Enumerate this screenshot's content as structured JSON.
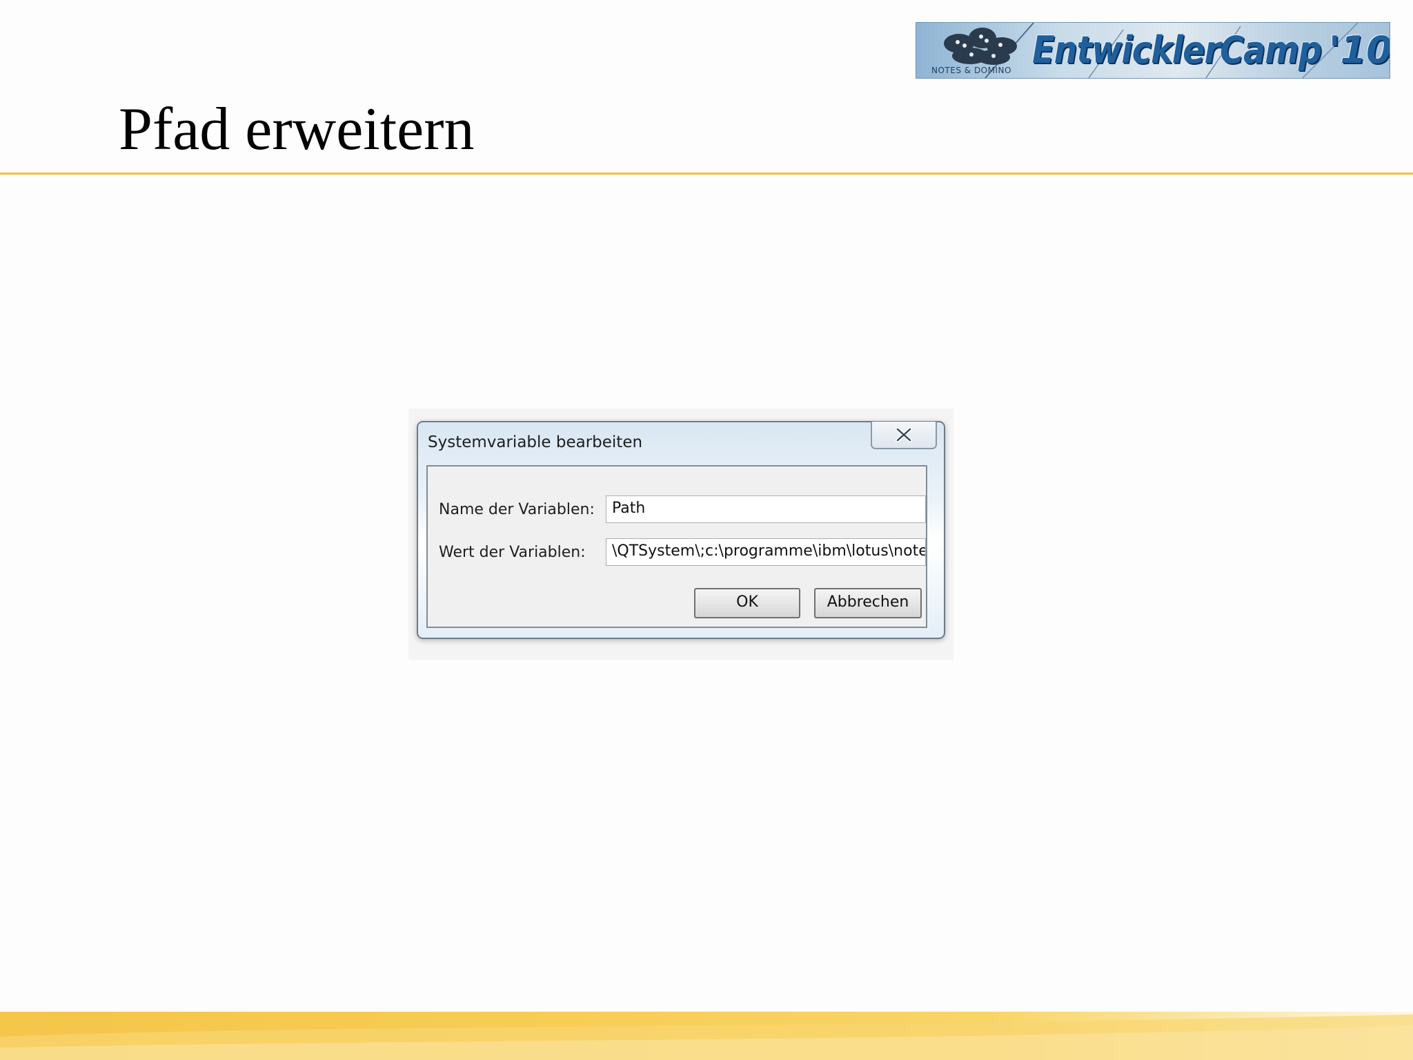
{
  "slide": {
    "title": "Pfad erweitern"
  },
  "logo": {
    "name": "EntwicklerCamp",
    "year": "'10",
    "sub": "NOTES & DOMINO"
  },
  "dialog": {
    "title": "Systemvariable bearbeiten",
    "name_label": "Name der Variablen:",
    "name_value": "Path",
    "value_label": "Wert der Variablen:",
    "value_value": "\\QTSystem\\;c:\\programme\\ibm\\lotus\\notes",
    "ok_label": "OK",
    "cancel_label": "Abbrechen",
    "close_icon": "close-x-icon"
  },
  "colors": {
    "accent_rule": "#f2c23a",
    "footer": "#f4c64a",
    "logo_text": "#1f5f9c"
  }
}
